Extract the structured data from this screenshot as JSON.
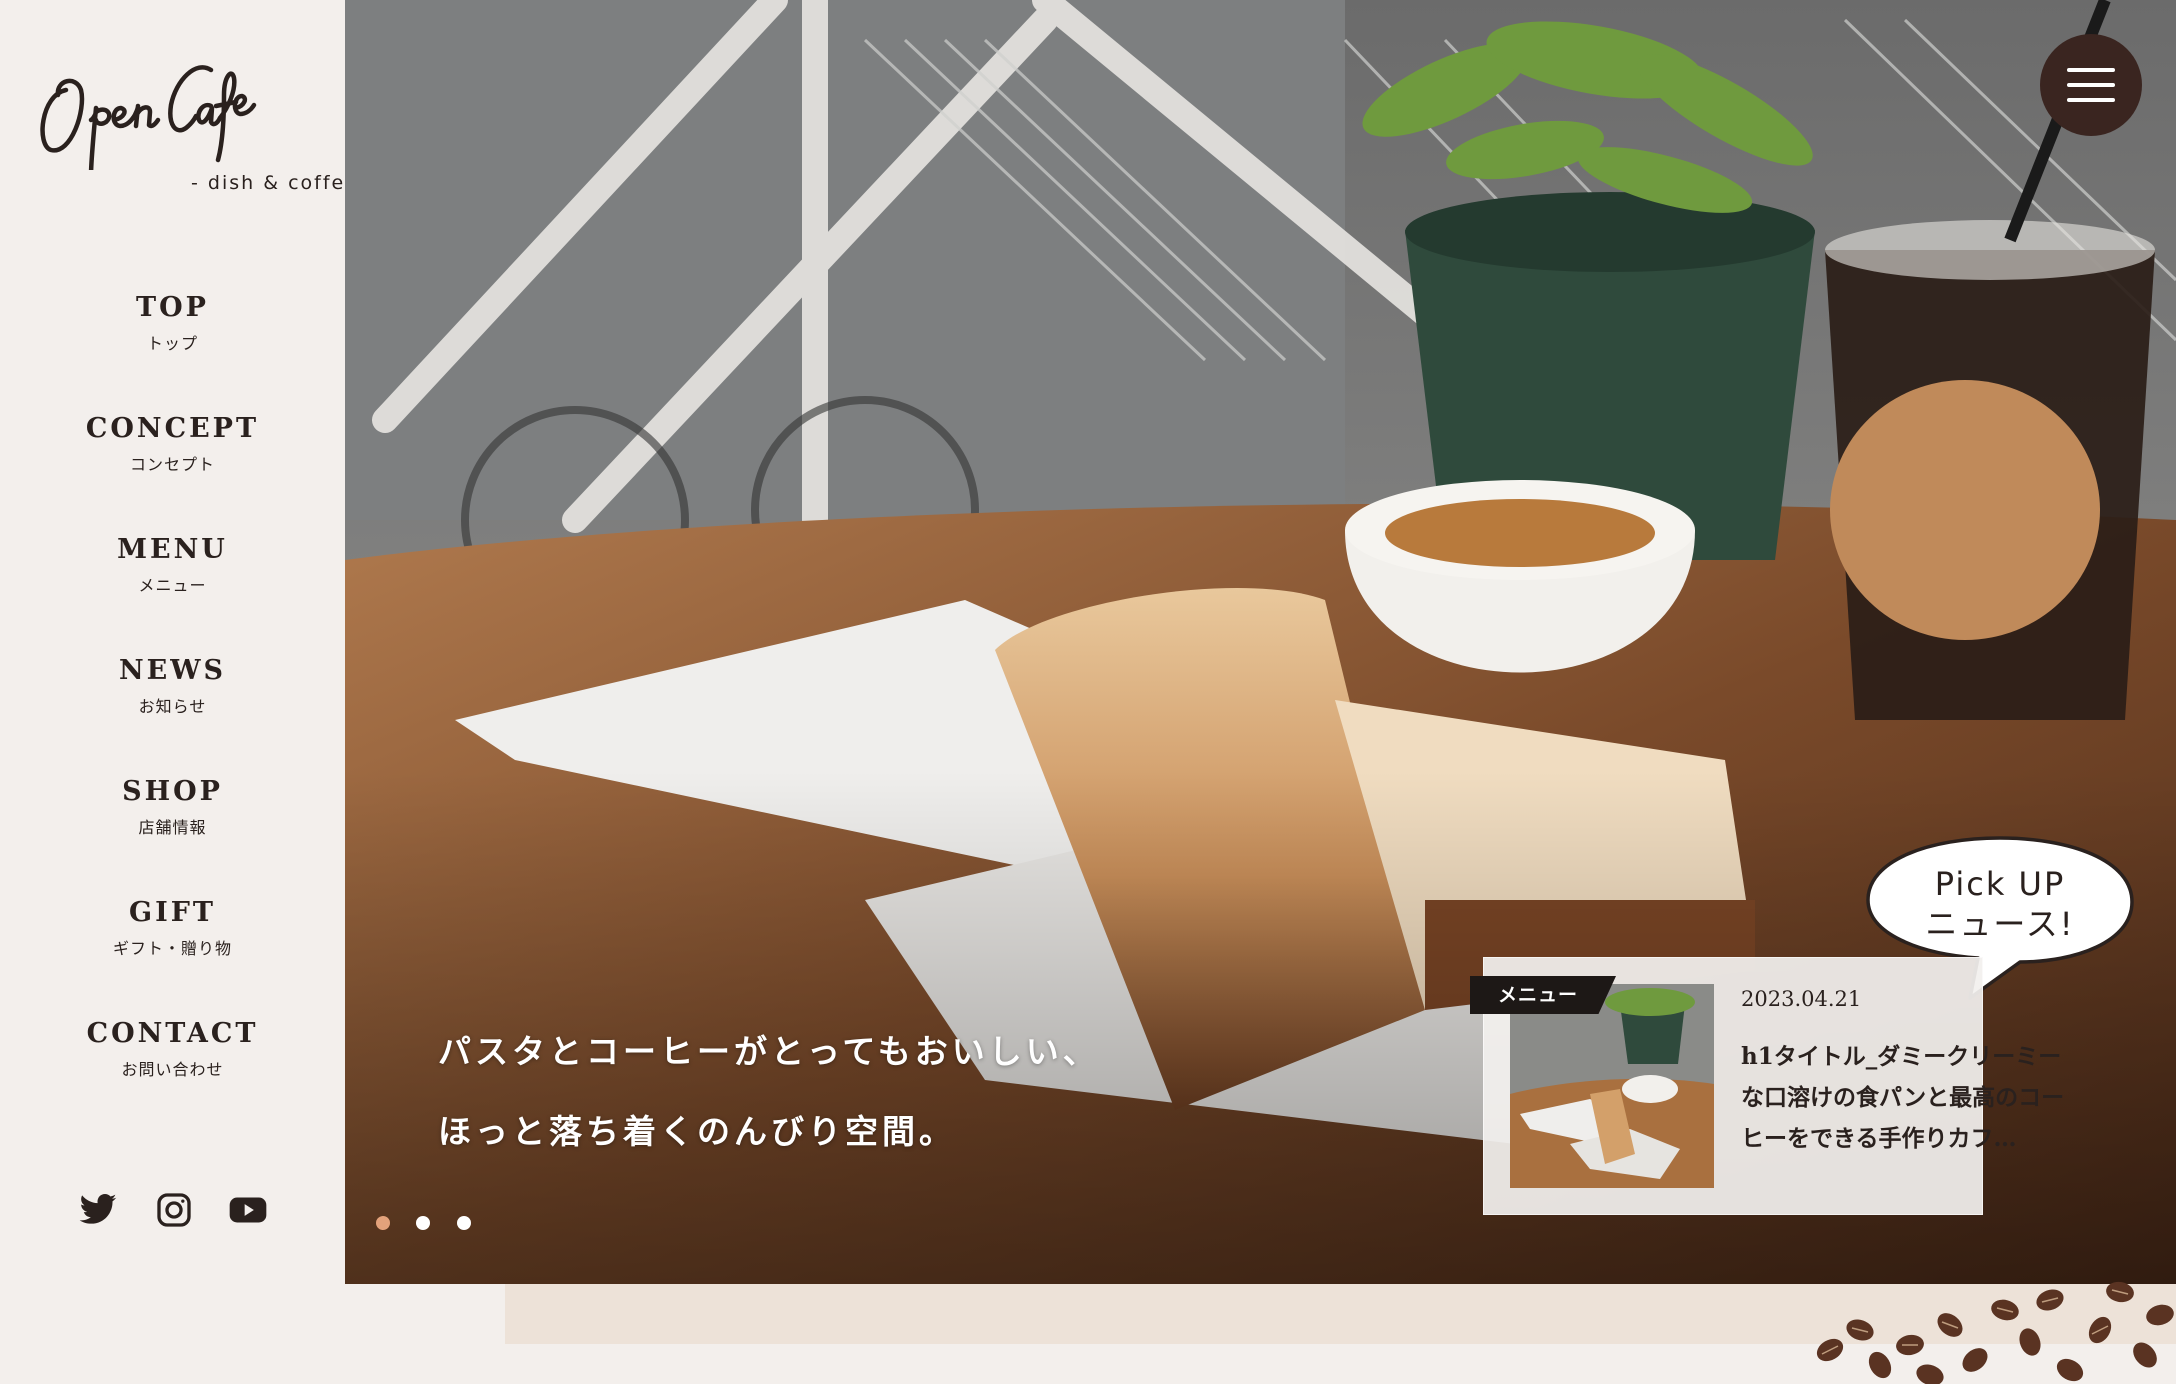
{
  "sidebar": {
    "logo": {
      "text": "OpenCafe",
      "subtitle": "- dish & coffee -"
    },
    "nav": [
      {
        "en": "TOP",
        "ja": "トップ"
      },
      {
        "en": "CONCEPT",
        "ja": "コンセプト"
      },
      {
        "en": "MENU",
        "ja": "メニュー"
      },
      {
        "en": "NEWS",
        "ja": "お知らせ"
      },
      {
        "en": "SHOP",
        "ja": "店舗情報"
      },
      {
        "en": "GIFT",
        "ja": "ギフト・贈り物"
      },
      {
        "en": "CONTACT",
        "ja": "お問い合わせ"
      }
    ],
    "social": [
      "twitter-icon",
      "instagram-icon",
      "youtube-icon"
    ]
  },
  "hero": {
    "catch_line1": "パスタとコーヒーがとってもおいしい、",
    "catch_line2": "ほっと落ち着くのんびり空間。",
    "slides_count": 3,
    "active_slide": 1,
    "active_dot_color": "#e3a27b"
  },
  "menu_button": {
    "icon": "hamburger-icon",
    "color": "#3a2520"
  },
  "pickup": {
    "bubble_line1": "Pick UP",
    "bubble_line2": "ニュース!",
    "tag": "メニュー",
    "date": "2023.04.21",
    "title": "h1タイトル_ダミークリーミーな口溶けの食パンと最高のコーヒーをできる手作りカフ…"
  },
  "colors": {
    "background": "#f3efec",
    "text": "#2a211e",
    "accent": "#e3a27b",
    "bottom_band": "#ede2d8"
  }
}
